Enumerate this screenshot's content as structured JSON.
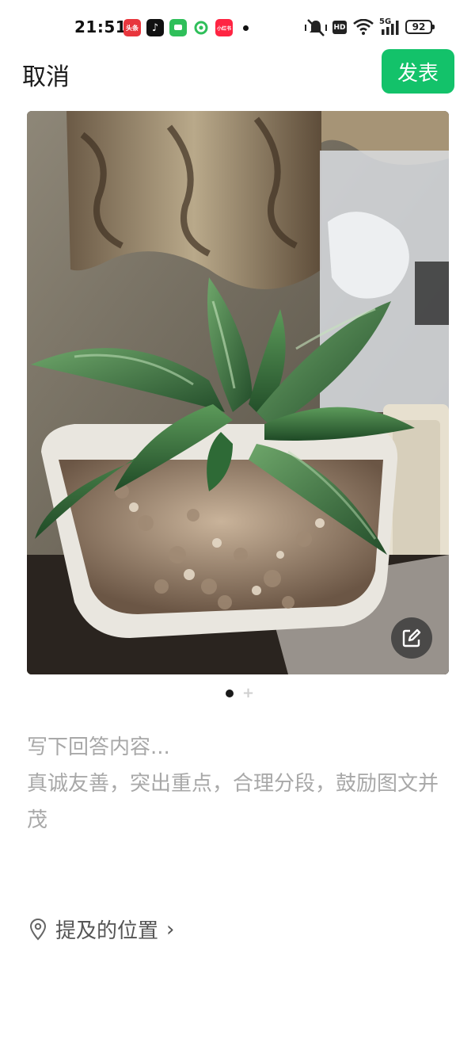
{
  "status_bar": {
    "time": "21:51",
    "app_icons": [
      {
        "name": "toutiao-icon",
        "label": "头条",
        "color": "#e8363d"
      },
      {
        "name": "tiktok-icon",
        "label": "♪",
        "color": "#111111"
      },
      {
        "name": "messages-icon",
        "label": "",
        "color": "#2fbf5a"
      },
      {
        "name": "clover-app-icon",
        "label": "",
        "color": "#2fbf5a"
      },
      {
        "name": "xiaohongshu-icon",
        "label": "小红书",
        "color": "#ff2442"
      }
    ],
    "network": "5G",
    "battery": "92"
  },
  "header": {
    "cancel_label": "取消",
    "publish_label": "发表",
    "accent": "#13c26a"
  },
  "photo": {
    "description_icon": "edit-icon"
  },
  "pager": {
    "current_page": 1,
    "add_symbol": "+"
  },
  "compose": {
    "placeholder": "写下回答内容...",
    "hint": "真诚友善，突出重点，合理分段，鼓励图文并茂"
  },
  "location": {
    "label": "提及的位置",
    "chevron": "›"
  }
}
